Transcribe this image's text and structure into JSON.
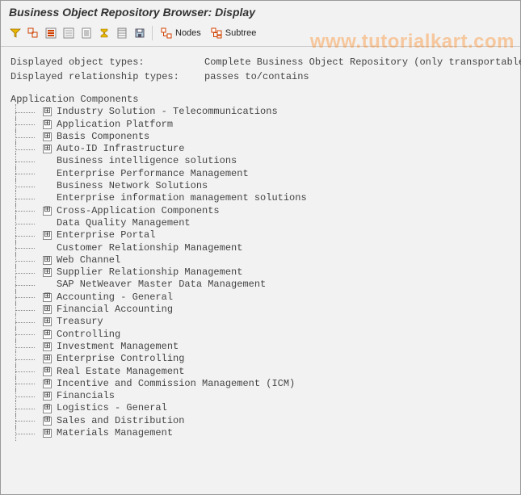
{
  "title": "Business Object Repository Browser: Display",
  "watermark": "www.tutorialkart.com",
  "toolbar": {
    "nodes_label": "Nodes",
    "subtree_label": "Subtree"
  },
  "info": {
    "label_object_types": "Displayed object types:",
    "value_object_types": "Complete Business Object Repository (only transportable)",
    "label_rel_types": "Displayed relationship types:",
    "value_rel_types": "passes to/contains"
  },
  "tree": {
    "root": "Application Components",
    "items": [
      {
        "label": "Industry Solution - Telecommunications",
        "expandable": true
      },
      {
        "label": "Application Platform",
        "expandable": true
      },
      {
        "label": "Basis Components",
        "expandable": true
      },
      {
        "label": "Auto-ID Infrastructure",
        "expandable": true
      },
      {
        "label": "Business intelligence solutions",
        "expandable": false
      },
      {
        "label": "Enterprise Performance Management",
        "expandable": false
      },
      {
        "label": "Business Network Solutions",
        "expandable": false
      },
      {
        "label": "Enterprise information management solutions",
        "expandable": false
      },
      {
        "label": "Cross-Application Components",
        "expandable": true
      },
      {
        "label": "Data Quality Management",
        "expandable": false
      },
      {
        "label": "Enterprise Portal",
        "expandable": true
      },
      {
        "label": "Customer Relationship Management",
        "expandable": false
      },
      {
        "label": "Web Channel",
        "expandable": true
      },
      {
        "label": "Supplier Relationship Management",
        "expandable": true
      },
      {
        "label": "SAP NetWeaver Master Data Management",
        "expandable": false
      },
      {
        "label": "Accounting - General",
        "expandable": true
      },
      {
        "label": "Financial Accounting",
        "expandable": true
      },
      {
        "label": "Treasury",
        "expandable": true
      },
      {
        "label": "Controlling",
        "expandable": true
      },
      {
        "label": "Investment Management",
        "expandable": true
      },
      {
        "label": "Enterprise Controlling",
        "expandable": true
      },
      {
        "label": "Real Estate Management",
        "expandable": true
      },
      {
        "label": "Incentive and Commission Management (ICM)",
        "expandable": true
      },
      {
        "label": "Financials",
        "expandable": true
      },
      {
        "label": "Logistics - General",
        "expandable": true
      },
      {
        "label": "Sales and Distribution",
        "expandable": true
      },
      {
        "label": "Materials Management",
        "expandable": true
      }
    ]
  }
}
